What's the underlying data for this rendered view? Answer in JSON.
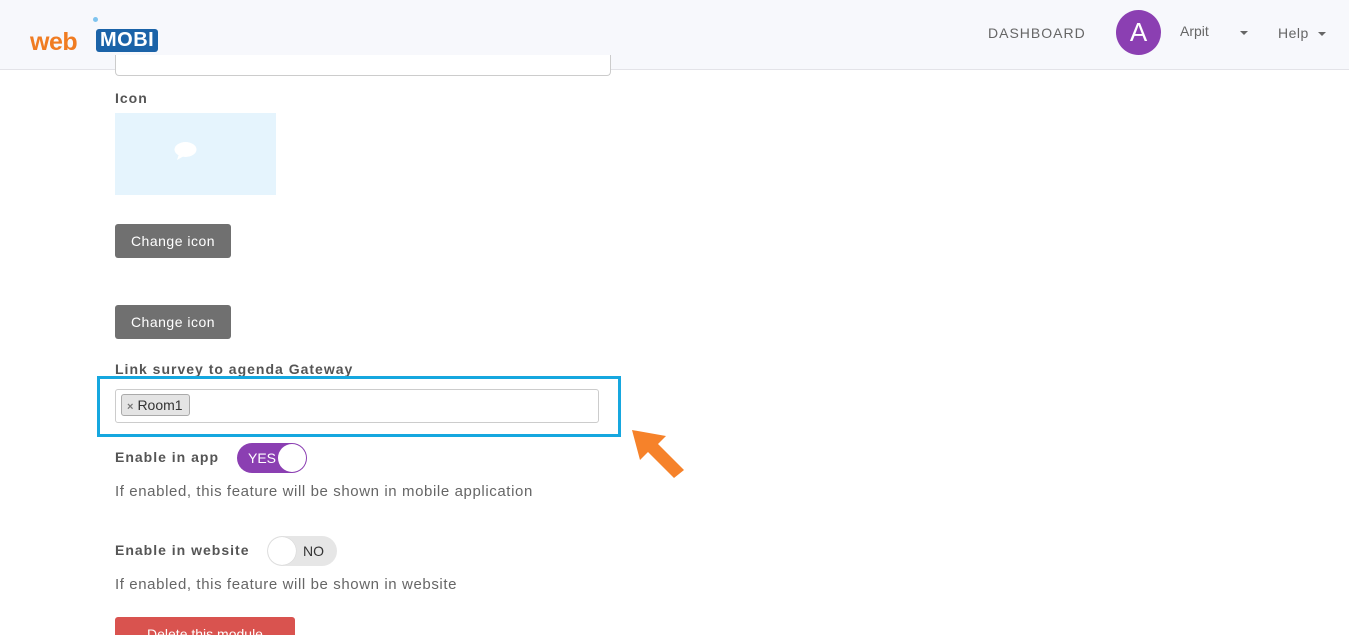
{
  "header": {
    "logo": {
      "part1": "web",
      "part2": "MOBI"
    },
    "dashboard_label": "DASHBOARD",
    "avatar_initial": "A",
    "user_name": "Arpit",
    "help_label": "Help"
  },
  "icon_section": {
    "label": "Icon",
    "icon_name": "chat-bubble-icon",
    "change_icon_label_1": "Change icon",
    "change_icon_label_2": "Change icon"
  },
  "link_survey": {
    "label": "Link survey to agenda Gateway",
    "tags": [
      "Room1"
    ],
    "remove_symbol": "×"
  },
  "enable_app": {
    "label": "Enable in app",
    "toggle_text": "YES",
    "toggle_on": true,
    "help": "If enabled, this feature will be shown in mobile application"
  },
  "enable_website": {
    "label": "Enable in website",
    "toggle_text": "NO",
    "toggle_on": false,
    "help": "If enabled, this feature will be shown in website"
  },
  "delete_button_label": "Delete this module",
  "colors": {
    "accent_purple": "#8b3fb2",
    "highlight_blue": "#16a7df",
    "arrow_orange": "#f6822a",
    "delete_red": "#d9534f"
  }
}
